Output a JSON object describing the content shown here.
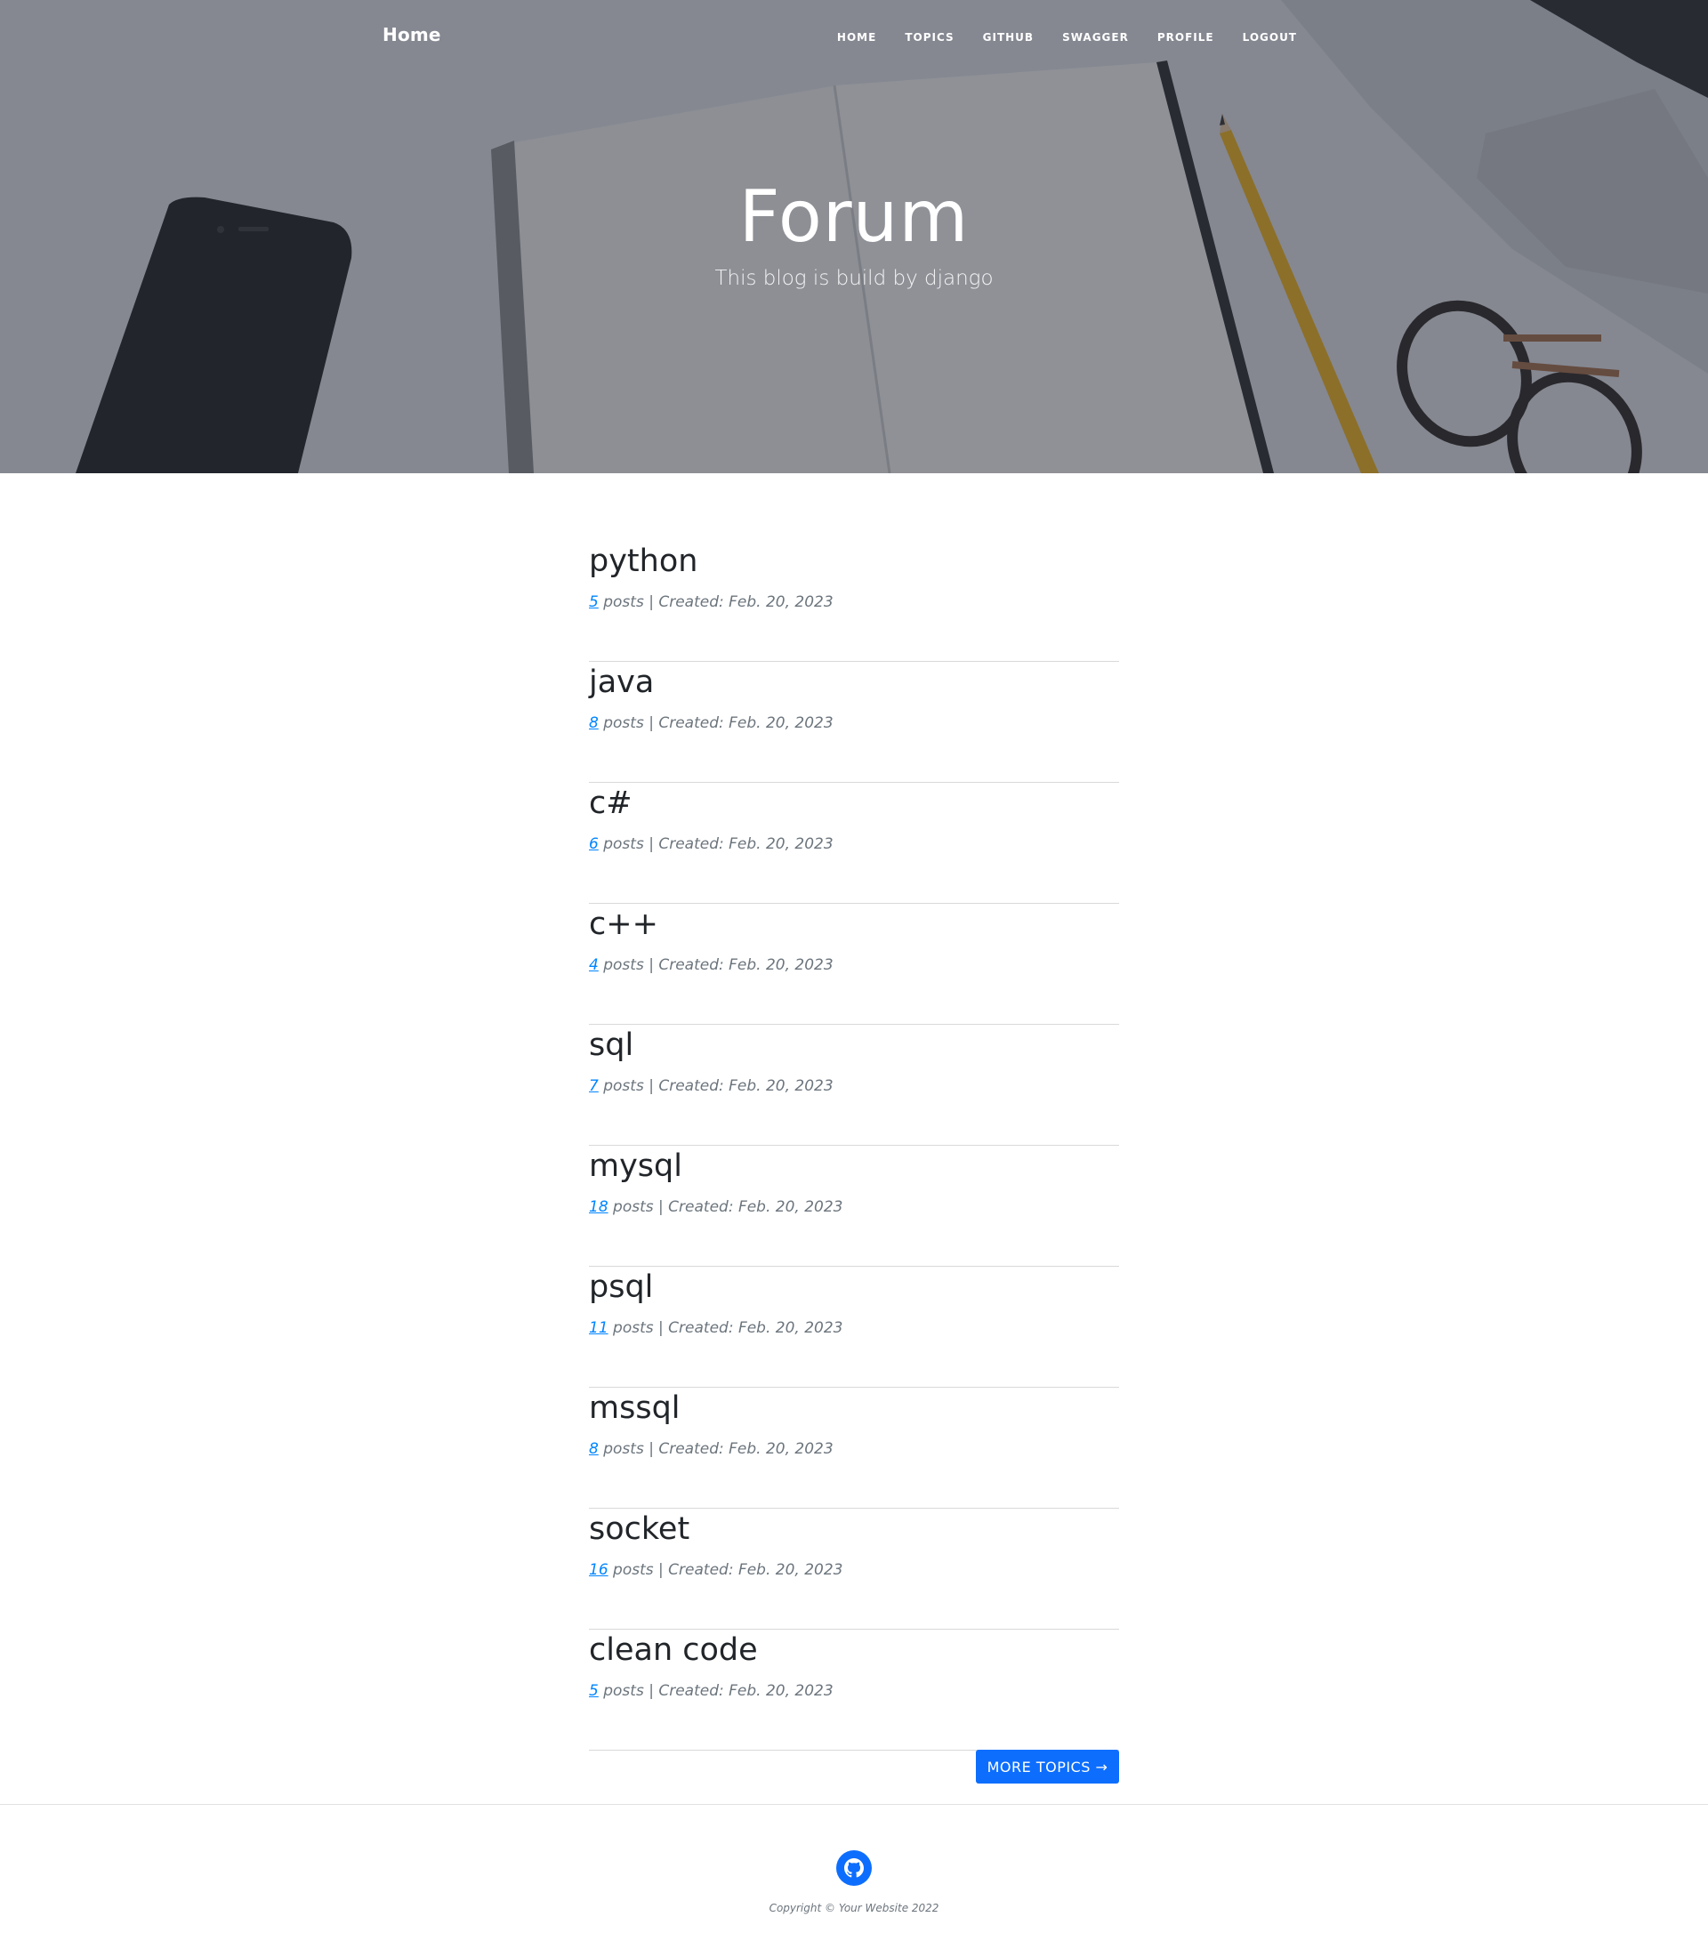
{
  "nav": {
    "brand": "Home",
    "links": [
      "HOME",
      "TOPICS",
      "GITHUB",
      "SWAGGER",
      "PROFILE",
      "LOGOUT"
    ]
  },
  "hero": {
    "title": "Forum",
    "subtitle": "This blog is build by django"
  },
  "topics": [
    {
      "name": "python",
      "count": "5",
      "posts_label": "posts",
      "created": "| Created: Feb. 20, 2023"
    },
    {
      "name": "java",
      "count": "8",
      "posts_label": "posts",
      "created": "| Created: Feb. 20, 2023"
    },
    {
      "name": "c#",
      "count": "6",
      "posts_label": "posts",
      "created": "| Created: Feb. 20, 2023"
    },
    {
      "name": "c++",
      "count": "4",
      "posts_label": "posts",
      "created": "| Created: Feb. 20, 2023"
    },
    {
      "name": "sql",
      "count": "7",
      "posts_label": "posts",
      "created": "| Created: Feb. 20, 2023"
    },
    {
      "name": "mysql",
      "count": "18",
      "posts_label": "posts",
      "created": "| Created: Feb. 20, 2023"
    },
    {
      "name": "psql",
      "count": "11",
      "posts_label": "posts",
      "created": "| Created: Feb. 20, 2023"
    },
    {
      "name": "mssql",
      "count": "8",
      "posts_label": "posts",
      "created": "| Created: Feb. 20, 2023"
    },
    {
      "name": "socket",
      "count": "16",
      "posts_label": "posts",
      "created": "| Created: Feb. 20, 2023"
    },
    {
      "name": "clean code",
      "count": "5",
      "posts_label": "posts",
      "created": "| Created: Feb. 20, 2023"
    }
  ],
  "more_button": "MORE TOPICS →",
  "footer": {
    "copyright": "Copyright © Your Website 2022",
    "icon": "github-icon"
  },
  "colors": {
    "accent": "#0d6efd",
    "count_link": "#0085ff",
    "muted_text": "#6c757d"
  }
}
